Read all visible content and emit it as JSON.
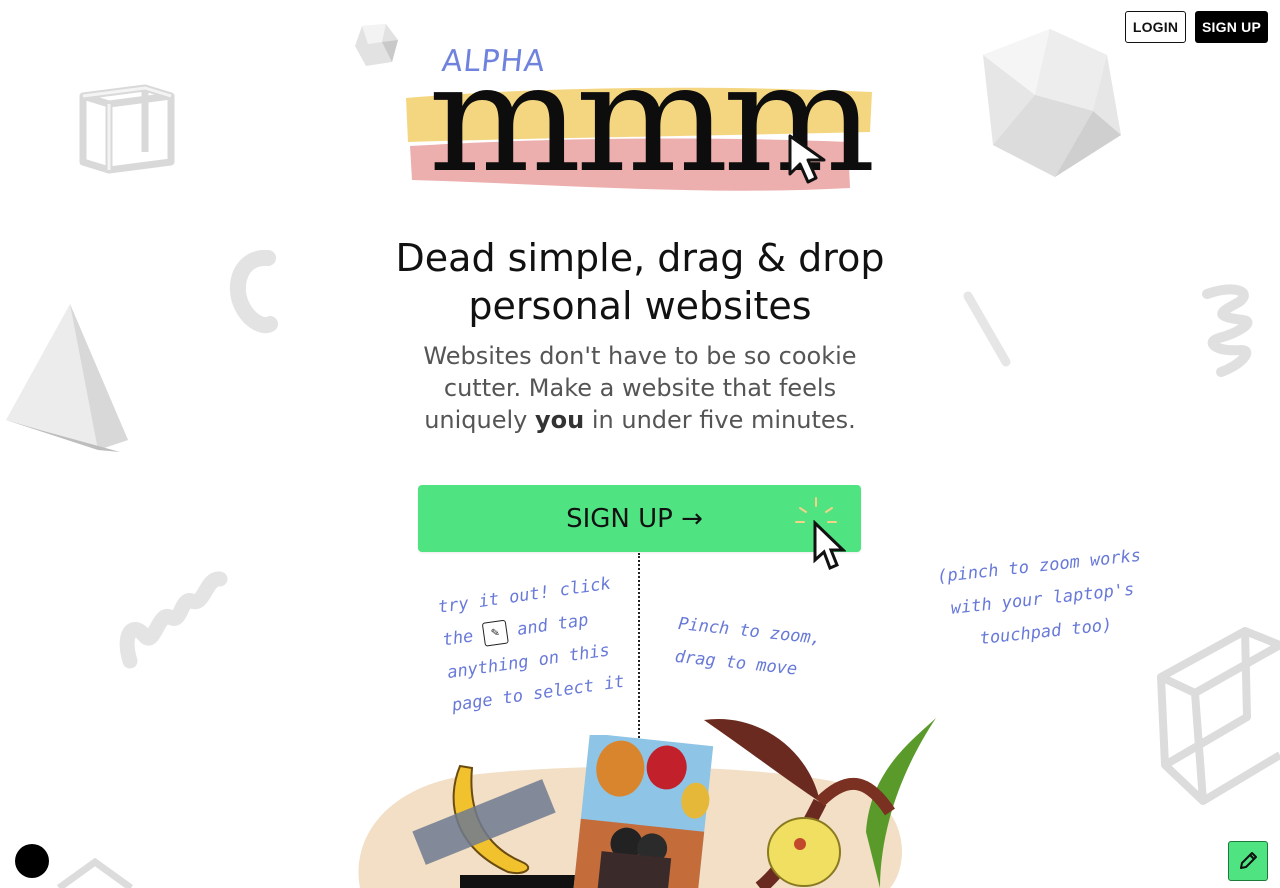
{
  "nav": {
    "login_label": "LOGIN",
    "signup_label": "SIGN UP"
  },
  "logo": {
    "badge": "ALPHA",
    "word": "mmm"
  },
  "hero": {
    "headline_line1": "Dead simple, drag & drop",
    "headline_line2": "personal websites",
    "sub_before": "Websites don't have to be so cookie cutter. Make a website that feels uniquely ",
    "sub_bold": "you",
    "sub_after": " in under five minutes."
  },
  "cta": {
    "label": "SIGN UP →"
  },
  "notes": {
    "try_line1": "try it out! click",
    "try_line2_a": "the",
    "try_line2_b": "and tap",
    "try_line3": "anything on this",
    "try_line4": "page to select it",
    "pinch_line1": "Pinch to zoom,",
    "pinch_line2": "drag to move",
    "laptop_line1": "(pinch to zoom works",
    "laptop_line2": "with your laptop's",
    "laptop_line3": "touchpad too)"
  },
  "icons": {
    "edit": "pencil-icon",
    "cursor": "arrow-cursor-icon"
  },
  "colors": {
    "accent_green": "#4fe382",
    "note_blue": "#6879d8",
    "brush_yellow": "#f3cf6a",
    "brush_pink": "#e99a9a"
  }
}
